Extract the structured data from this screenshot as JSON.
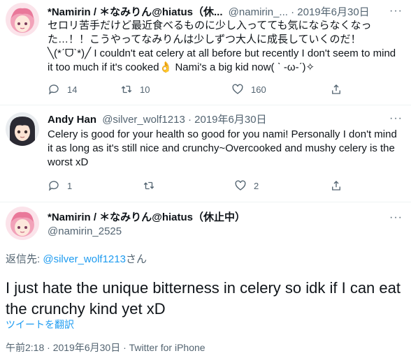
{
  "tweets": [
    {
      "author_name": "*Namirin / ＊なみりん@hiatus（休...",
      "handle": "@namirin_...",
      "dot": "·",
      "date": "2019年6月30日",
      "more": "···",
      "text": "セロリ苦手だけど最近食べるものに少し入ってても気にならなくなった…！！こうやってなみりんは少しずつ大人に成長していくのだ！╲(*ˊᗜˋ*)╱ I couldn't eat celery at all before but recently I don't seem to mind it too much if it's cooked👌 Nami's a big kid now( ˋ -ω-ˊ)✧",
      "actions": {
        "reply": "14",
        "retweet": "10",
        "like": "160"
      }
    },
    {
      "author_name": "Andy Han",
      "handle": "@silver_wolf1213",
      "dot": "·",
      "date": "2019年6月30日",
      "more": "···",
      "text": "Celery is good for your health so good for you nami! Personally I don't mind it as long as it's still nice and crunchy~Overcooked and mushy celery is the worst xD",
      "actions": {
        "reply": "1",
        "retweet": "",
        "like": "2"
      }
    }
  ],
  "main_tweet": {
    "author_name": "*Namirin / ＊なみりん@hiatus（休止中）",
    "handle": "@namirin_2525",
    "more": "···",
    "reply_prefix": "返信先:",
    "reply_to": "@silver_wolf1213",
    "reply_suffix": "さん",
    "text": "I just hate the unique bitterness in celery so idk if I can eat the crunchy kind yet xD",
    "translate_label": "ツイートを翻訳",
    "meta": "午前2:18 · 2019年6月30日 · Twitter for iPhone"
  },
  "colors": {
    "text": "#0f1419",
    "secondary": "#536471",
    "link": "#1d9bf0",
    "divider": "#eff3f4"
  },
  "icons": [
    "reply-icon",
    "retweet-icon",
    "like-icon",
    "share-icon",
    "more-icon",
    "avatar-anime-pink-hair",
    "avatar-anime-dark-hair"
  ]
}
